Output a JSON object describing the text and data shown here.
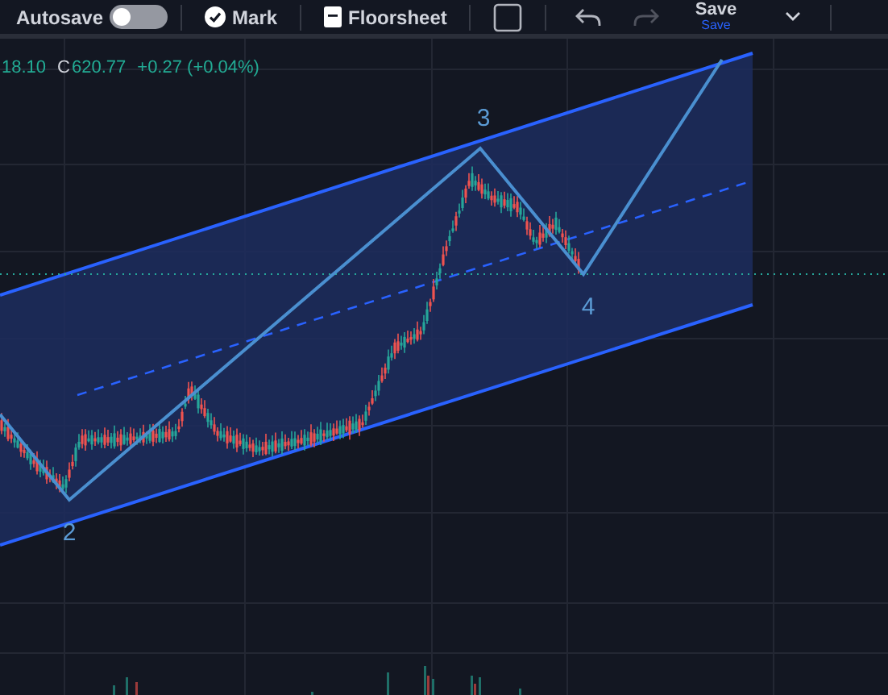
{
  "toolbar": {
    "autosave": {
      "label": "Autosave",
      "on": false
    },
    "mark": {
      "label": "Mark"
    },
    "floorsheet": {
      "label": "Floorsheet"
    },
    "redo": {
      "disabled": true
    },
    "save": {
      "label": "Save",
      "sublabel": "Save"
    }
  },
  "legend": {
    "open_value": "18.10",
    "close_label": "C",
    "close_value": "620.77",
    "change": "+0.27 (+0.04%)"
  },
  "wave_labels": [
    "2",
    "3",
    "4"
  ]
}
